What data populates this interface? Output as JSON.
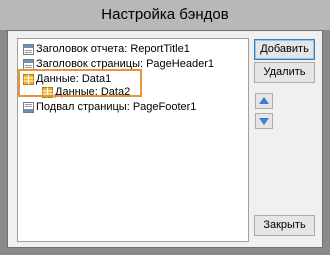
{
  "window": {
    "title": "Настройка бэндов"
  },
  "bands": [
    {
      "label": "Заголовок отчета: ReportTitle1",
      "icon": "band-header-icon"
    },
    {
      "label": "Заголовок страницы: PageHeader1",
      "icon": "band-header-icon"
    },
    {
      "label": "Данные: Data1",
      "icon": "data-band-icon"
    },
    {
      "label": "Данные: Data2",
      "icon": "data-band-icon"
    },
    {
      "label": "Подвал страницы: PageFooter1",
      "icon": "band-footer-icon"
    }
  ],
  "buttons": {
    "add": "Добавить",
    "delete": "Удалить",
    "move_up_icon": "arrow-up-icon",
    "move_down_icon": "arrow-down-icon",
    "close": "Закрыть"
  },
  "colors": {
    "highlight": "#e8953a",
    "accent": "#3c7fb1",
    "data_icon": "#f0b429"
  }
}
